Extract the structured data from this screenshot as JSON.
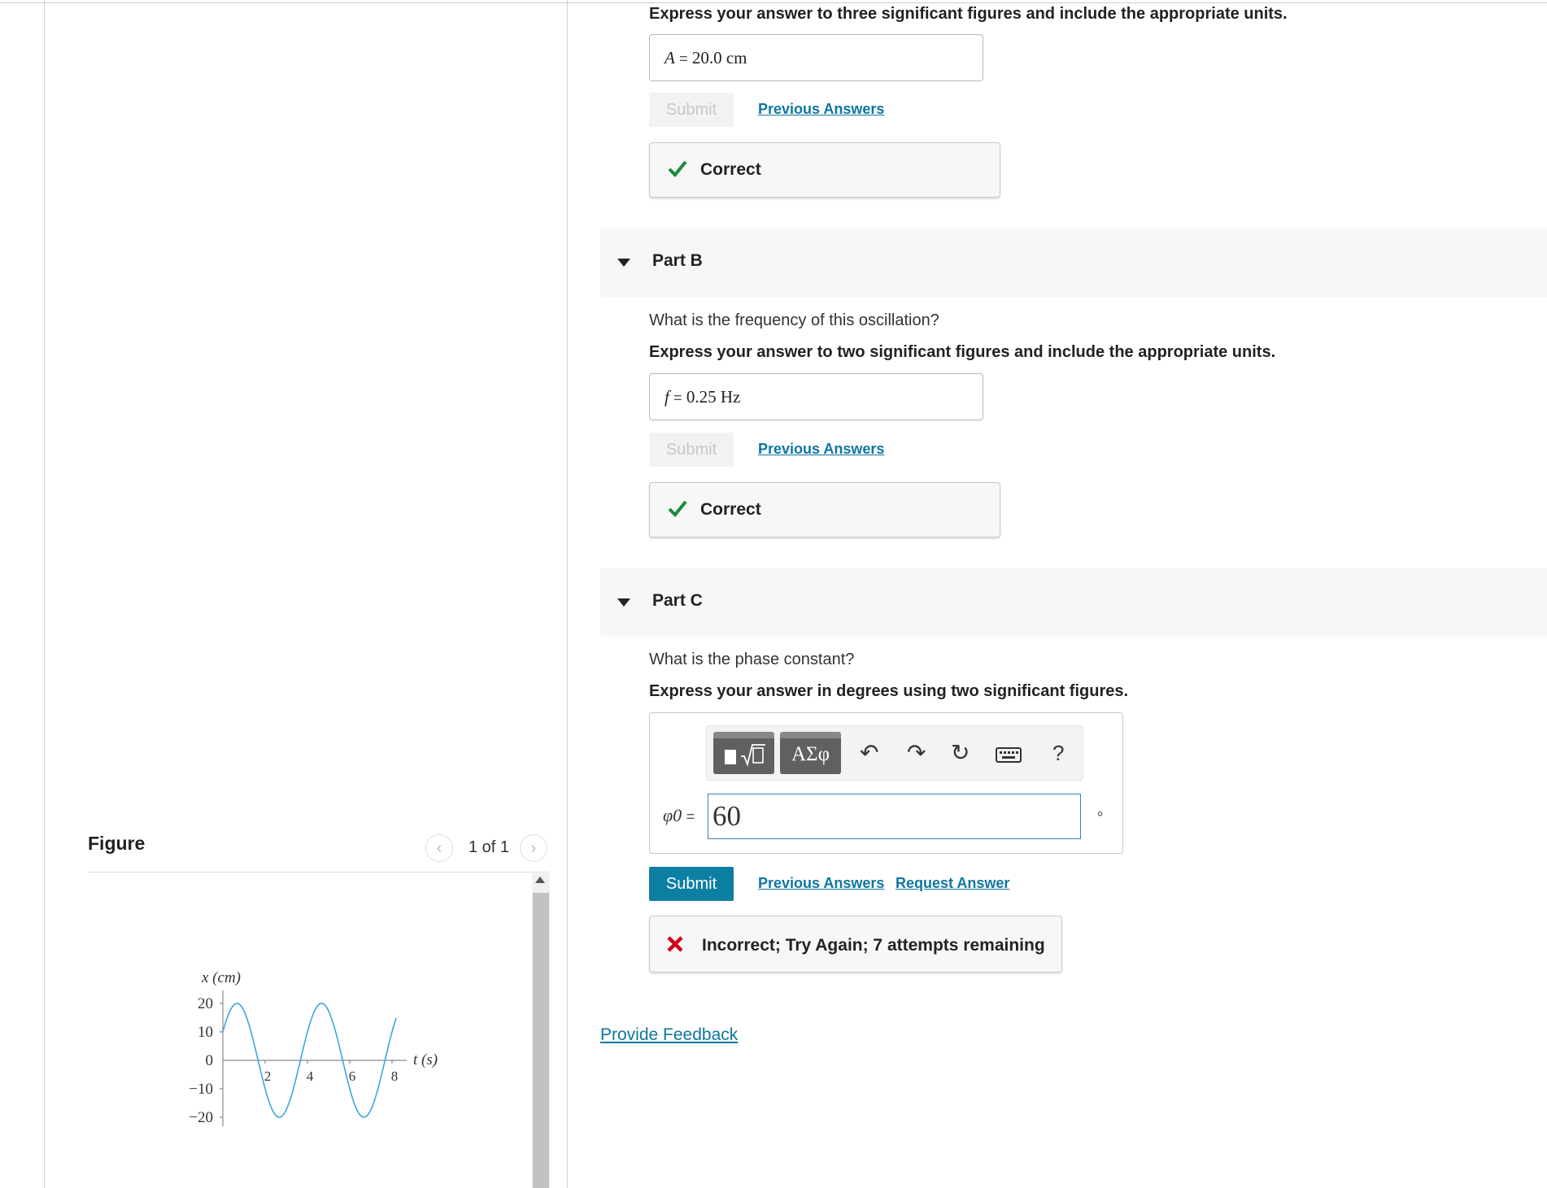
{
  "part_a": {
    "instruction": "Express your answer to three significant figures and include the appropriate units.",
    "var": "A",
    "eq": "=",
    "answer": "20.0 cm",
    "submit_label": "Submit",
    "prev_label": "Previous Answers",
    "result": "Correct"
  },
  "part_b": {
    "header": "Part B",
    "question": "What is the frequency of this oscillation?",
    "instruction": "Express your answer to two significant figures and include the appropriate units.",
    "var": "f",
    "eq": "=",
    "answer": "0.25 Hz",
    "submit_label": "Submit",
    "prev_label": "Previous Answers",
    "result": "Correct"
  },
  "part_c": {
    "header": "Part C",
    "question": "What is the phase constant?",
    "instruction": "Express your answer in degrees using two significant figures.",
    "var": "φ0",
    "eq": "=",
    "input_value": "60",
    "unit": "∘",
    "toolbar": {
      "template_icon": "fraction-sqrt-template-icon",
      "greek_label": "ΑΣφ",
      "help_label": "?"
    },
    "submit_label": "Submit",
    "prev_label": "Previous Answers",
    "request_label": "Request Answer",
    "result": "Incorrect; Try Again; 7 attempts remaining"
  },
  "feedback_link": "Provide Feedback",
  "figure": {
    "title": "Figure",
    "pager": "1 of 1",
    "graph": {
      "y_label": "x (cm)",
      "x_label": "t (s)",
      "y_ticks": [
        "20",
        "10",
        "0",
        "−10",
        "−20"
      ],
      "x_ticks": [
        "2",
        "4",
        "6",
        "8"
      ]
    }
  },
  "colors": {
    "accent": "#0d7fa3",
    "link": "#0f76a1",
    "correct": "#1a8a3a",
    "incorrect": "#d0021b",
    "curve": "#3aa7dc"
  }
}
